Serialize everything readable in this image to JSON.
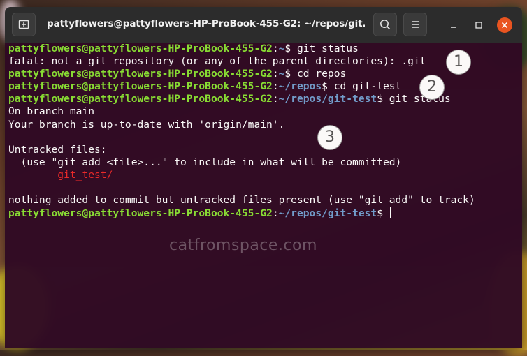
{
  "window": {
    "title": "pattyflowers@pattyflowers-HP-ProBook-455-G2: ~/repos/git..."
  },
  "icons": {
    "new_tab": "new-tab-icon",
    "search": "search-icon",
    "menu": "hamburger-menu-icon",
    "minimize": "minimize-icon",
    "maximize": "maximize-icon",
    "close": "close-icon"
  },
  "colors": {
    "terminal_bg": "#300a24",
    "prompt_user": "#8ae234",
    "prompt_path": "#729fcf",
    "untracked": "#ef2929",
    "close_button": "#e95420"
  },
  "terminal": {
    "lines": [
      {
        "user": "pattyflowers@pattyflowers-HP-ProBook-455-G2",
        "sep": ":",
        "path": "~",
        "sym": "$",
        "cmd": " git status"
      },
      {
        "text": "fatal: not a git repository (or any of the parent directories): .git"
      },
      {
        "user": "pattyflowers@pattyflowers-HP-ProBook-455-G2",
        "sep": ":",
        "path": "~",
        "sym": "$",
        "cmd": " cd repos"
      },
      {
        "user": "pattyflowers@pattyflowers-HP-ProBook-455-G2",
        "sep": ":",
        "path": "~/repos",
        "sym": "$",
        "cmd": " cd git-test"
      },
      {
        "user": "pattyflowers@pattyflowers-HP-ProBook-455-G2",
        "sep": ":",
        "path": "~/repos/git-test",
        "sym": "$",
        "cmd": " git status"
      },
      {
        "text": "On branch main"
      },
      {
        "text": "Your branch is up-to-date with 'origin/main'."
      },
      {
        "text": ""
      },
      {
        "text": "Untracked files:"
      },
      {
        "text": "  (use \"git add <file>...\" to include in what will be committed)"
      },
      {
        "indent": "        ",
        "red": "git_test/"
      },
      {
        "text": ""
      },
      {
        "text": "nothing added to commit but untracked files present (use \"git add\" to track)"
      },
      {
        "user": "pattyflowers@pattyflowers-HP-ProBook-455-G2",
        "sep": ":",
        "path": "~/repos/git-test",
        "sym": "$",
        "cmd": " ",
        "cursor": true
      }
    ]
  },
  "annotations": {
    "badge1": "1",
    "badge2": "2",
    "badge3": "3"
  },
  "watermark": "catfromspace.com"
}
